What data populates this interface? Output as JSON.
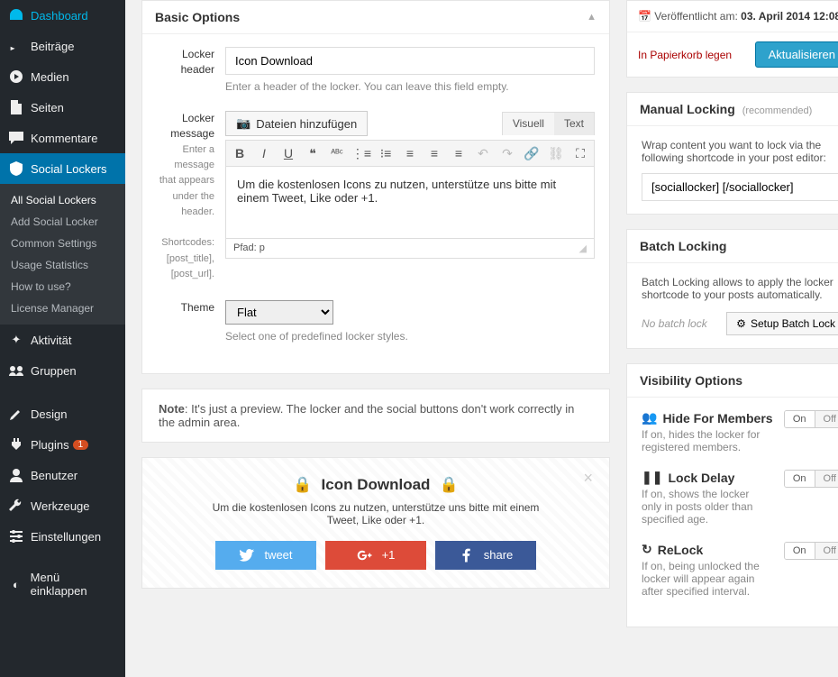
{
  "menu": {
    "dashboard": "Dashboard",
    "beitraege": "Beiträge",
    "medien": "Medien",
    "seiten": "Seiten",
    "kommentare": "Kommentare",
    "social_lockers": "Social Lockers",
    "sub_all": "All Social Lockers",
    "sub_add": "Add Social Locker",
    "sub_common": "Common Settings",
    "sub_usage": "Usage Statistics",
    "sub_howto": "How to use?",
    "sub_license": "License Manager",
    "aktivitaet": "Aktivität",
    "gruppen": "Gruppen",
    "design": "Design",
    "plugins": "Plugins",
    "plugins_badge": "1",
    "benutzer": "Benutzer",
    "werkzeuge": "Werkzeuge",
    "einstellungen": "Einstellungen",
    "collapse": "Menü einklappen"
  },
  "basic": {
    "title": "Basic Options",
    "header_label": "Locker header",
    "header_value": "Icon Download",
    "header_desc": "Enter a header of the locker. You can leave this field empty.",
    "message_label": "Locker message",
    "message_hint": "Enter a message that appears under the header.",
    "shortcodes_hint": "Shortcodes: [post_title], [post_url].",
    "media_btn": "Dateien hinzufügen",
    "tab_visual": "Visuell",
    "tab_text": "Text",
    "editor_content": "Um die kostenlosen Icons zu nutzen, unterstütze uns bitte mit einem Tweet, Like oder +1.",
    "path": "Pfad: p",
    "theme_label": "Theme",
    "theme_value": "Flat",
    "theme_desc": "Select one of predefined locker styles."
  },
  "note": {
    "label": "Note",
    "text": ": It's just a preview. The locker and the social buttons don't work correctly in the admin area."
  },
  "preview": {
    "title": "Icon Download",
    "message": "Um die kostenlosen Icons zu nutzen, unterstütze uns bitte mit einem Tweet, Like oder +1.",
    "tweet": "tweet",
    "plus": "+1",
    "share": "share"
  },
  "publish": {
    "label": "Veröffentlicht am: ",
    "date": "03. April 2014 12:08",
    "trash": "In Papierkorb legen",
    "update": "Aktualisieren"
  },
  "manual": {
    "title": "Manual Locking",
    "rec": "(recommended)",
    "desc": "Wrap content you want to lock via the following shortcode in your post editor:",
    "code": "[sociallocker] [/sociallocker]"
  },
  "batch": {
    "title": "Batch Locking",
    "desc": "Batch Locking allows to apply the locker shortcode to your posts automatically.",
    "status": "No batch lock",
    "btn": "Setup Batch Lock"
  },
  "vis": {
    "title": "Visibility Options",
    "hide_title": "Hide For Members",
    "hide_desc": "If on, hides the locker for registered members.",
    "delay_title": "Lock Delay",
    "delay_desc": "If on, shows the locker only in posts older than specified age.",
    "relock_title": "ReLock",
    "relock_desc": "If on, being unlocked the locker will appear again after specified interval.",
    "on": "On",
    "off": "Off"
  }
}
